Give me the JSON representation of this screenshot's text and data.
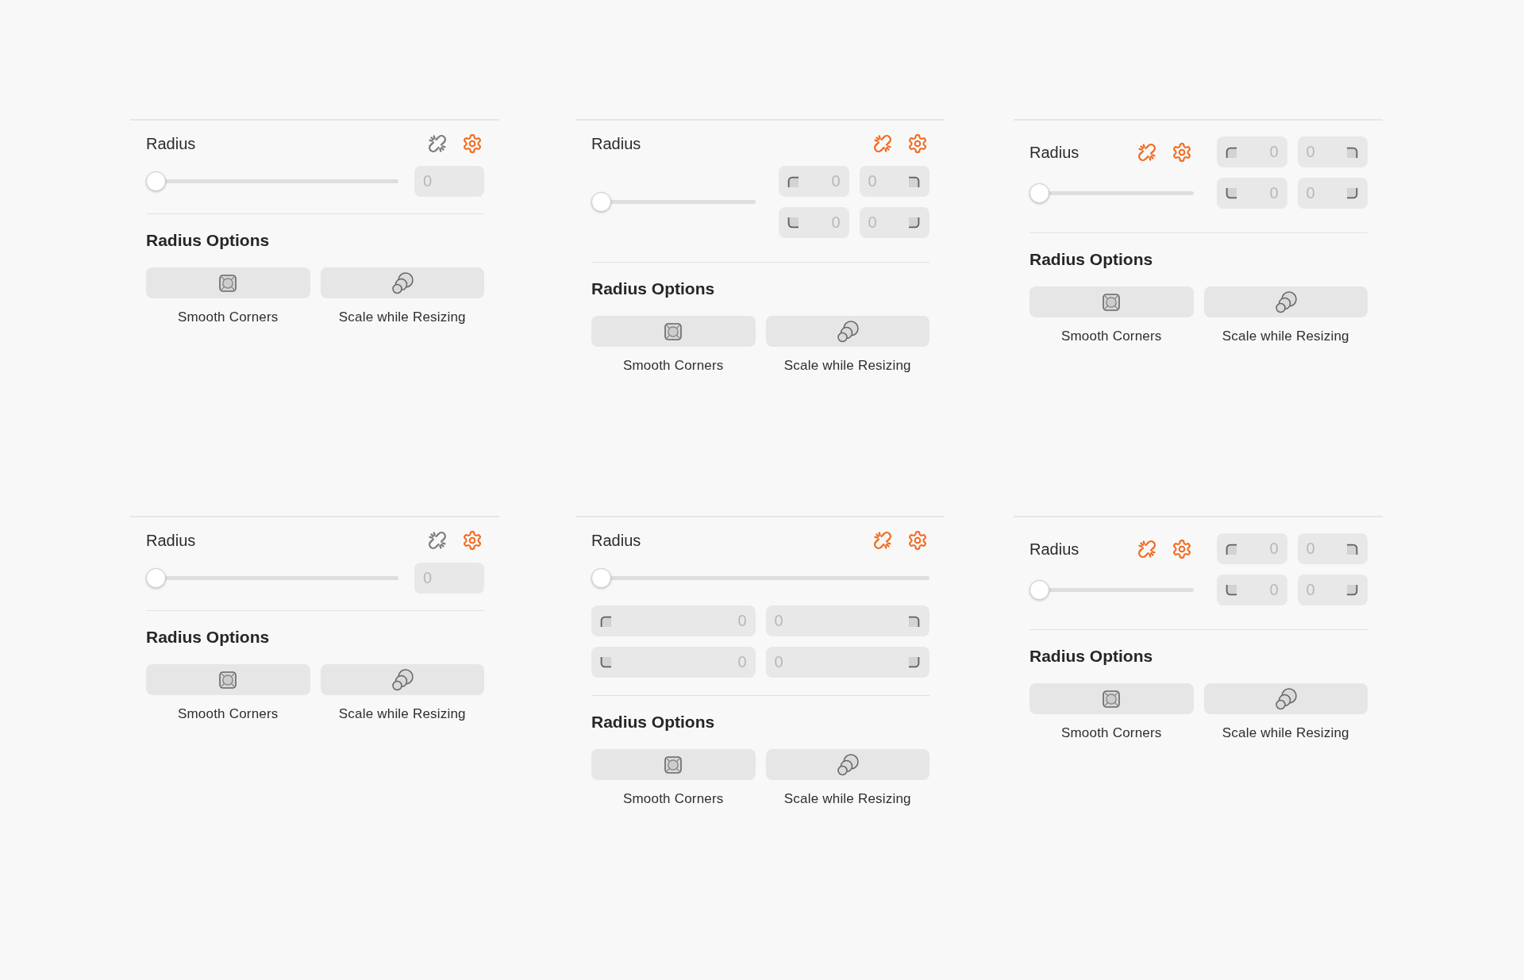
{
  "panels": [
    {
      "kind": "single",
      "title": "Radius",
      "unlink": {
        "active": false
      },
      "slider": {
        "level": 0
      },
      "radius_input": {
        "placeholder": "0"
      },
      "options_title": "Radius Options",
      "options": [
        {
          "kind": "smooth",
          "label": "Smooth Corners"
        },
        {
          "kind": "scale",
          "label": "Scale while Resizing"
        }
      ]
    },
    {
      "kind": "split",
      "title": "Radius",
      "unlink": {
        "active": true
      },
      "slider": {
        "level": 0
      },
      "corner_inputs": [
        {
          "kind": "top-left",
          "placeholder": "0"
        },
        {
          "kind": "top-right",
          "placeholder": "0"
        },
        {
          "kind": "bottom-left",
          "placeholder": "0"
        },
        {
          "kind": "bottom-right",
          "placeholder": "0"
        }
      ],
      "options_title": "Radius Options",
      "options": [
        {
          "kind": "smooth",
          "label": "Smooth Corners"
        },
        {
          "kind": "scale",
          "label": "Scale while Resizing"
        }
      ]
    },
    {
      "kind": "compact",
      "title": "Radius",
      "unlink": {
        "active": true
      },
      "slider": {
        "level": 0
      },
      "corner_inputs": [
        {
          "kind": "top-left",
          "placeholder": "0"
        },
        {
          "kind": "top-right",
          "placeholder": "0"
        },
        {
          "kind": "bottom-left",
          "placeholder": "0"
        },
        {
          "kind": "bottom-right",
          "placeholder": "0"
        }
      ],
      "options_title": "Radius Options",
      "options": [
        {
          "kind": "smooth",
          "label": "Smooth Corners"
        },
        {
          "kind": "scale",
          "label": "Scale while Resizing"
        }
      ]
    },
    {
      "kind": "single",
      "title": "Radius",
      "unlink": {
        "active": false
      },
      "slider": {
        "level": 0
      },
      "radius_input": {
        "placeholder": "0"
      },
      "options_title": "Radius Options",
      "options": [
        {
          "kind": "smooth",
          "label": "Smooth Corners"
        },
        {
          "kind": "scale",
          "label": "Scale while Resizing"
        }
      ]
    },
    {
      "kind": "stacked",
      "title": "Radius",
      "unlink": {
        "active": true
      },
      "slider": {
        "level": 0
      },
      "corner_inputs": [
        {
          "kind": "top-left",
          "placeholder": "0"
        },
        {
          "kind": "top-right",
          "placeholder": "0"
        },
        {
          "kind": "bottom-left",
          "placeholder": "0"
        },
        {
          "kind": "bottom-right",
          "placeholder": "0"
        }
      ],
      "options_title": "Radius Options",
      "options": [
        {
          "kind": "smooth",
          "label": "Smooth Corners"
        },
        {
          "kind": "scale",
          "label": "Scale while Resizing"
        }
      ]
    },
    {
      "kind": "compact",
      "title": "Radius",
      "unlink": {
        "active": true
      },
      "slider": {
        "level": 0
      },
      "corner_inputs": [
        {
          "kind": "top-left",
          "placeholder": "0"
        },
        {
          "kind": "top-right",
          "placeholder": "0"
        },
        {
          "kind": "bottom-left",
          "placeholder": "0"
        },
        {
          "kind": "bottom-right",
          "placeholder": "0"
        }
      ],
      "options_title": "Radius Options",
      "options": [
        {
          "kind": "smooth",
          "label": "Smooth Corners"
        },
        {
          "kind": "scale",
          "label": "Scale while Resizing"
        }
      ]
    }
  ]
}
